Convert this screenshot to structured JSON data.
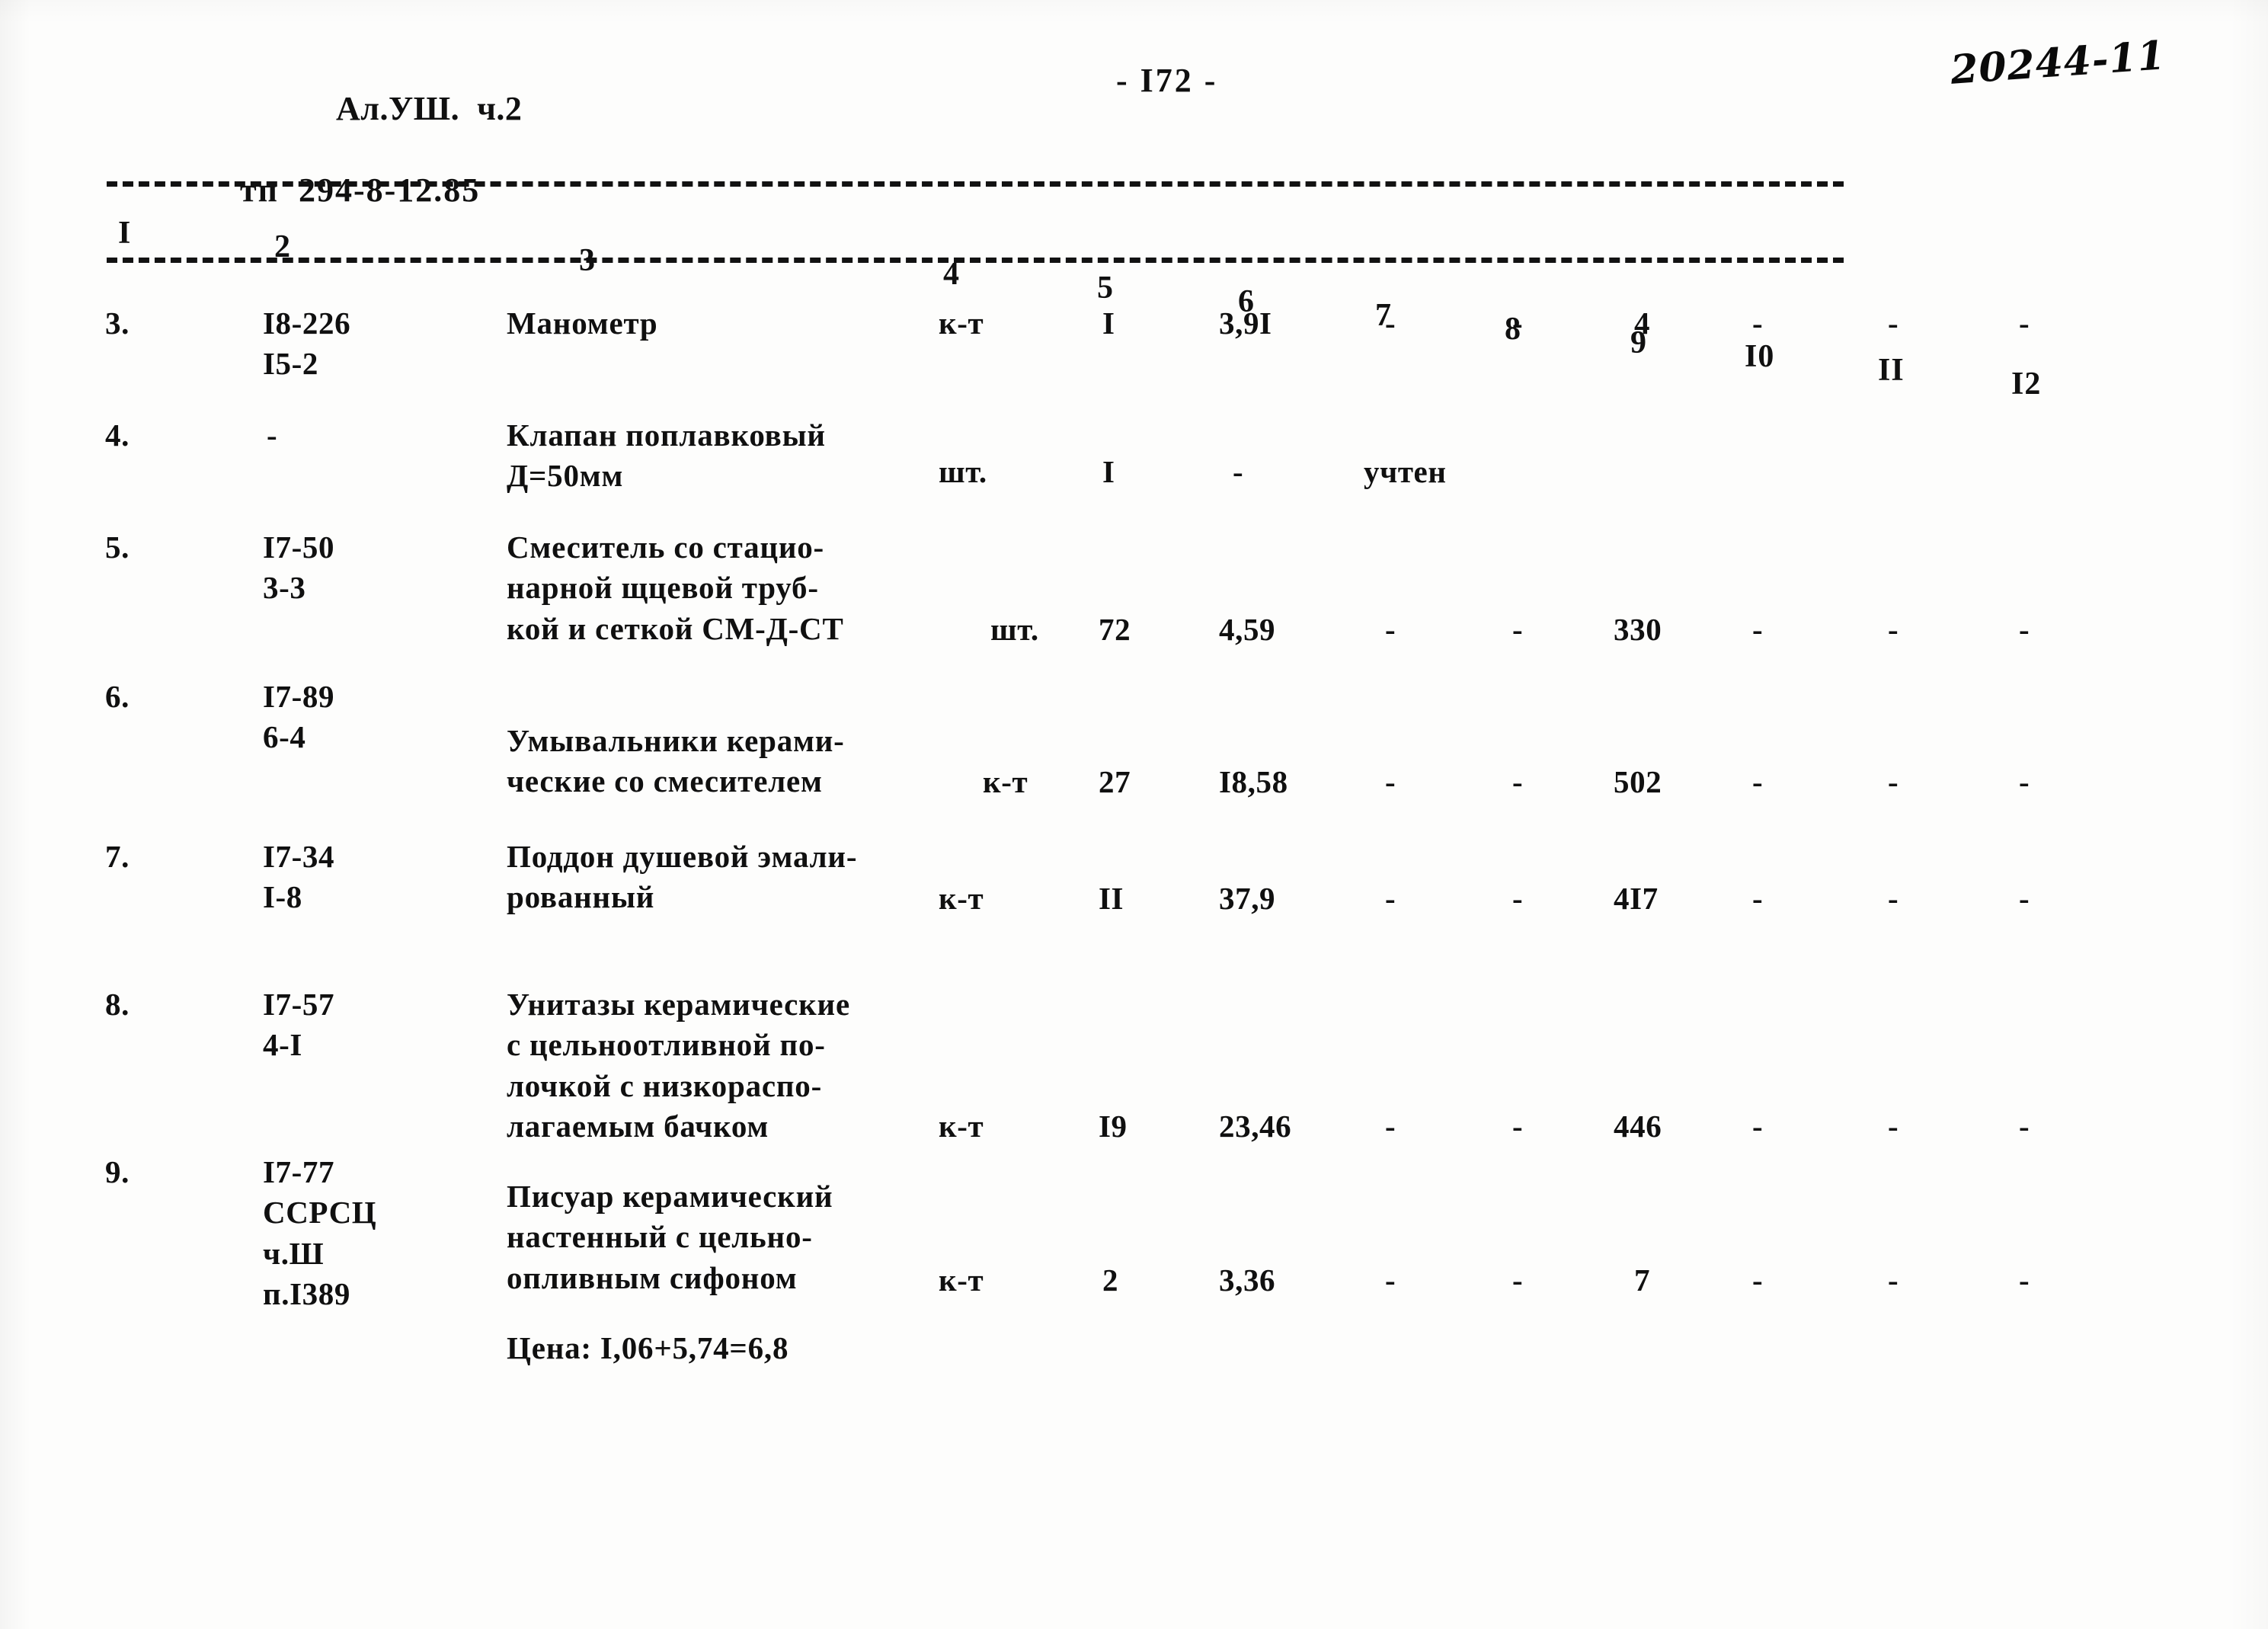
{
  "header": {
    "doc_ref_line1": "Ал.УШ.  ч.2",
    "doc_ref_line2": "тп  294-8-12.85",
    "page_number": "- I72 -",
    "archive_stamp": "20244-11"
  },
  "table": {
    "column_numbers": [
      "I",
      "2",
      "3",
      "4",
      "5",
      "6",
      "7",
      "8",
      "9",
      "I0",
      "II",
      "I2"
    ],
    "rows": [
      {
        "no": "3.",
        "code": "I8-226\nI5-2",
        "description": "Манометр",
        "unit": "к-т",
        "qty": "I",
        "c6": "3,9I",
        "c7": "-",
        "c8": "-",
        "c9": "4",
        "c10": "-",
        "c11": "-",
        "c12": "-"
      },
      {
        "no": "4.",
        "code": "-",
        "description": "Клапан поплавковый\nД=50мм",
        "unit": "шт.",
        "qty": "I",
        "c6": "-",
        "c7": "учтен",
        "c8": "",
        "c9": "",
        "c10": "",
        "c11": "",
        "c12": ""
      },
      {
        "no": "5.",
        "code": "I7-50\n3-3",
        "description": "Смеситель со стацио-\nнарной щцевой труб-\nкой и сеткой СМ-Д-СТ",
        "unit": "шт.",
        "qty": "72",
        "c6": "4,59",
        "c7": "-",
        "c8": "-",
        "c9": "330",
        "c10": "-",
        "c11": "-",
        "c12": "-"
      },
      {
        "no": "6.",
        "code": "I7-89\n6-4",
        "description": "Умывальники керами-\nческие со смесителем",
        "unit": "к-т",
        "qty": "27",
        "c6": "I8,58",
        "c7": "-",
        "c8": "-",
        "c9": "502",
        "c10": "-",
        "c11": "-",
        "c12": "-"
      },
      {
        "no": "7.",
        "code": "I7-34\nI-8",
        "description": "Поддон душевой эмали-\nрованный",
        "unit": "к-т",
        "qty": "II",
        "c6": "37,9",
        "c7": "-",
        "c8": "-",
        "c9": "4I7",
        "c10": "-",
        "c11": "-",
        "c12": "-"
      },
      {
        "no": "8.",
        "code": "I7-57\n4-I",
        "description": "Унитазы керамические\nс цельноотливной по-\nлочкой с низкораспо-\nлагаемым бачком",
        "unit": "к-т",
        "qty": "I9",
        "c6": "23,46",
        "c7": "-",
        "c8": "-",
        "c9": "446",
        "c10": "-",
        "c11": "-",
        "c12": "-"
      },
      {
        "no": "9.",
        "code": "I7-77\nССРСЦ\nч.Ш\nп.I389",
        "description": "Писуар керамический\nнастенный с цельно-\nопливным сифоном",
        "unit": "к-т",
        "qty": "2",
        "c6": "3,36",
        "c7": "-",
        "c8": "-",
        "c9": "7",
        "c10": "-",
        "c11": "-",
        "c12": "-"
      }
    ],
    "footnote": "Цена: I,06+5,74=6,8"
  }
}
